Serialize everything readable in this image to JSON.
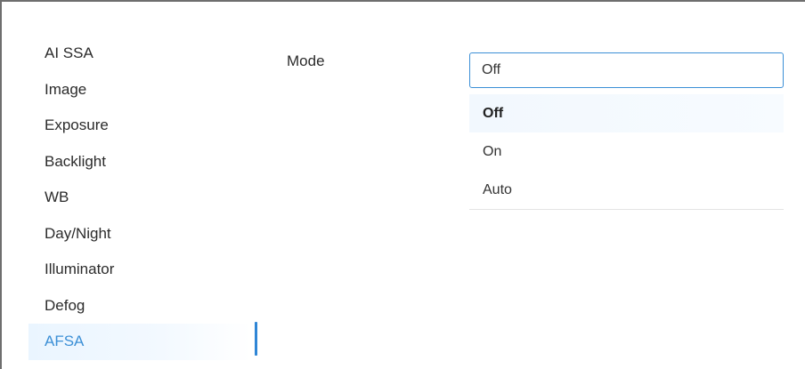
{
  "sidebar": {
    "items": [
      {
        "label": "AI SSA"
      },
      {
        "label": "Image"
      },
      {
        "label": "Exposure"
      },
      {
        "label": "Backlight"
      },
      {
        "label": "WB"
      },
      {
        "label": "Day/Night"
      },
      {
        "label": "Illuminator"
      },
      {
        "label": "Defog"
      },
      {
        "label": "AFSA"
      }
    ],
    "active": "AFSA"
  },
  "main": {
    "mode_label": "Mode",
    "mode_select": {
      "value": "Off",
      "options": [
        {
          "label": "Off",
          "selected": true
        },
        {
          "label": "On",
          "selected": false
        },
        {
          "label": "Auto",
          "selected": false
        }
      ]
    }
  },
  "colors": {
    "accent": "#3b8fd6",
    "active_bg": "#eaf5ff",
    "text": "#2b2b2b",
    "frame_border": "#6e6e6e"
  }
}
